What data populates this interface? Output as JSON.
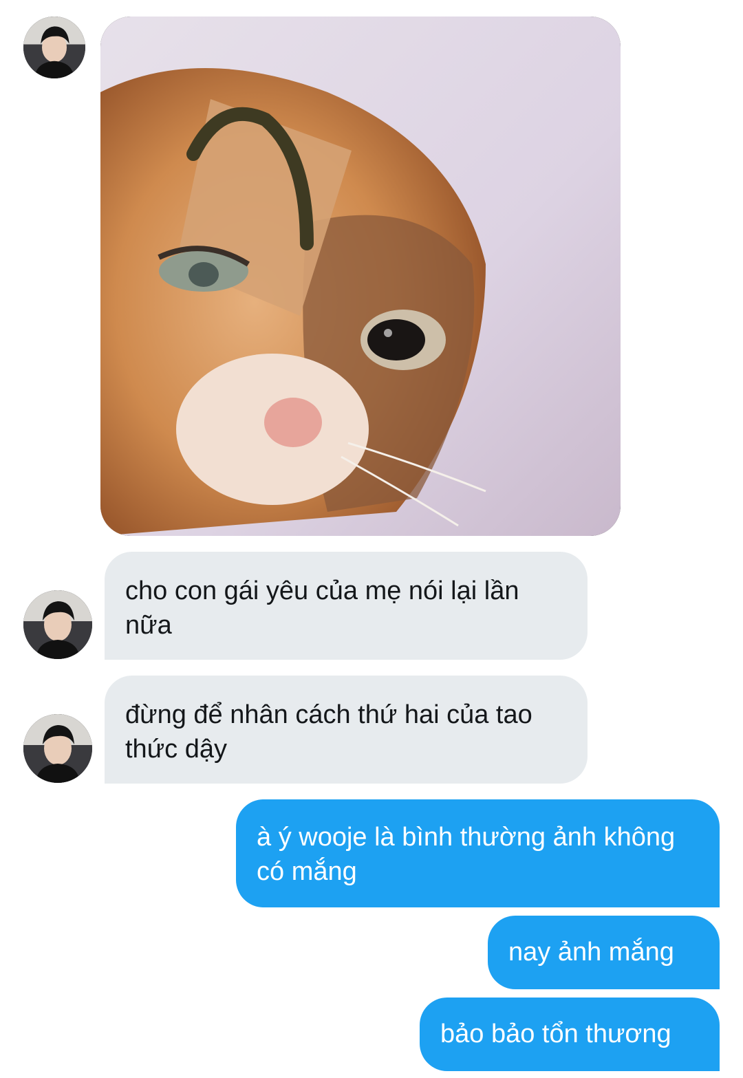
{
  "conversation": {
    "messages": [
      {
        "direction": "in",
        "type": "image",
        "description_icon": "photo"
      },
      {
        "direction": "in",
        "type": "text",
        "text": "cho con gái yêu của mẹ nói lại lần nữa"
      },
      {
        "direction": "in",
        "type": "text",
        "text": "đừng để nhân cách thứ hai của tao thức dậy"
      },
      {
        "direction": "out",
        "type": "text",
        "text": "à ý wooje là bình thường ảnh không có mắng"
      },
      {
        "direction": "out",
        "type": "text",
        "text": "nay ảnh mắng"
      },
      {
        "direction": "out",
        "type": "text",
        "text": "bảo bảo tổn thương"
      }
    ]
  },
  "colors": {
    "incoming_bubble": "#e7ebee",
    "outgoing_bubble": "#1da1f2",
    "incoming_text": "#14171a",
    "outgoing_text": "#ffffff"
  }
}
